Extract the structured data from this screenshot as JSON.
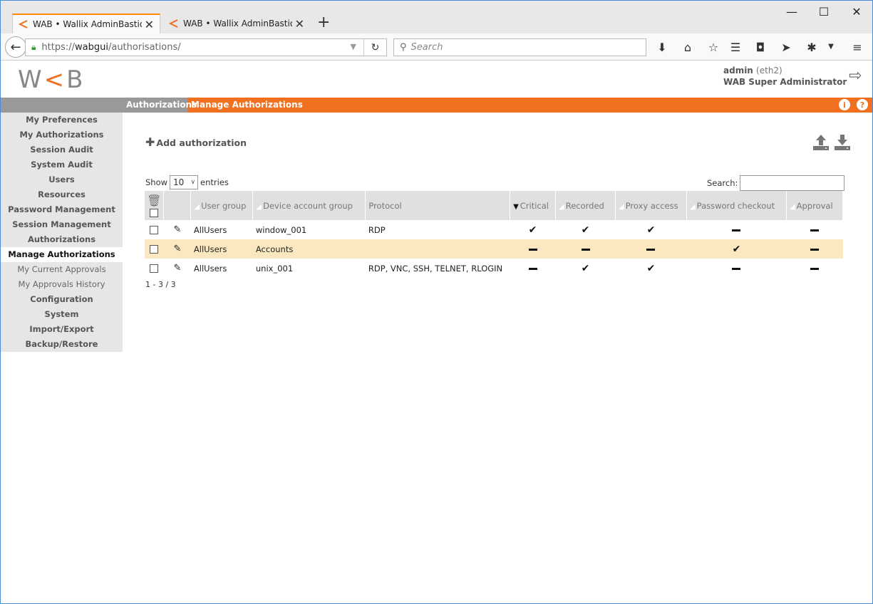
{
  "browser": {
    "tabs": [
      {
        "label": "WAB • Wallix AdminBastion",
        "active": true
      },
      {
        "label": "WAB • Wallix AdminBastion",
        "active": false
      }
    ],
    "new_tab": "+",
    "url_prefix": "https://",
    "url_host": "wabgui",
    "url_path": "/authorisations/",
    "search_placeholder": "Search",
    "window_controls": {
      "minimize": "—",
      "maximize": "☐",
      "close": "✕"
    }
  },
  "app": {
    "logo_left": "W",
    "logo_accent": "<",
    "logo_right": "B",
    "user_name": "admin",
    "user_host": "(eth2)",
    "user_role": "WAB Super Administrator"
  },
  "breadcrumb": {
    "section": "Authorizations",
    "page": "Manage Authorizations",
    "info": "i",
    "help": "?"
  },
  "sidebar": {
    "items": [
      {
        "label": "My Preferences",
        "type": "top"
      },
      {
        "label": "My Authorizations",
        "type": "top"
      },
      {
        "label": "Session Audit",
        "type": "top"
      },
      {
        "label": "System Audit",
        "type": "top"
      },
      {
        "label": "Users",
        "type": "top"
      },
      {
        "label": "Resources",
        "type": "top"
      },
      {
        "label": "Password Management",
        "type": "top"
      },
      {
        "label": "Session Management",
        "type": "top"
      },
      {
        "label": "Authorizations",
        "type": "top"
      },
      {
        "label": "Manage Authorizations",
        "type": "active"
      },
      {
        "label": "My Current Approvals",
        "type": "sub"
      },
      {
        "label": "My Approvals History",
        "type": "sub"
      },
      {
        "label": "Configuration",
        "type": "top"
      },
      {
        "label": "System",
        "type": "top"
      },
      {
        "label": "Import/Export",
        "type": "top"
      },
      {
        "label": "Backup/Restore",
        "type": "top"
      }
    ]
  },
  "main": {
    "add_label": "Add authorization",
    "show_label": "Show",
    "entries_value": "10",
    "entries_label": "entries",
    "search_label": "Search:",
    "pager": "1 - 3 / 3",
    "columns": [
      "User group",
      "Device account group",
      "Protocol",
      "Critical",
      "Recorded",
      "Proxy access",
      "Password checkout",
      "Approval"
    ],
    "rows": [
      {
        "user_group": "AllUsers",
        "device_account_group": "window_001",
        "protocol": "RDP",
        "critical": true,
        "recorded": true,
        "proxy": true,
        "checkout": false,
        "approval": false,
        "highlight": false
      },
      {
        "user_group": "AllUsers",
        "device_account_group": "Accounts",
        "protocol": "",
        "critical": false,
        "recorded": false,
        "proxy": false,
        "checkout": true,
        "approval": false,
        "highlight": true
      },
      {
        "user_group": "AllUsers",
        "device_account_group": "unix_001",
        "protocol": "RDP, VNC, SSH, TELNET, RLOGIN",
        "critical": false,
        "recorded": true,
        "proxy": true,
        "checkout": false,
        "approval": false,
        "highlight": false
      }
    ]
  },
  "colors": {
    "accent": "#f07020",
    "sidebar_bg": "#e6e6e6",
    "highlight_row": "#fbe8c0"
  }
}
